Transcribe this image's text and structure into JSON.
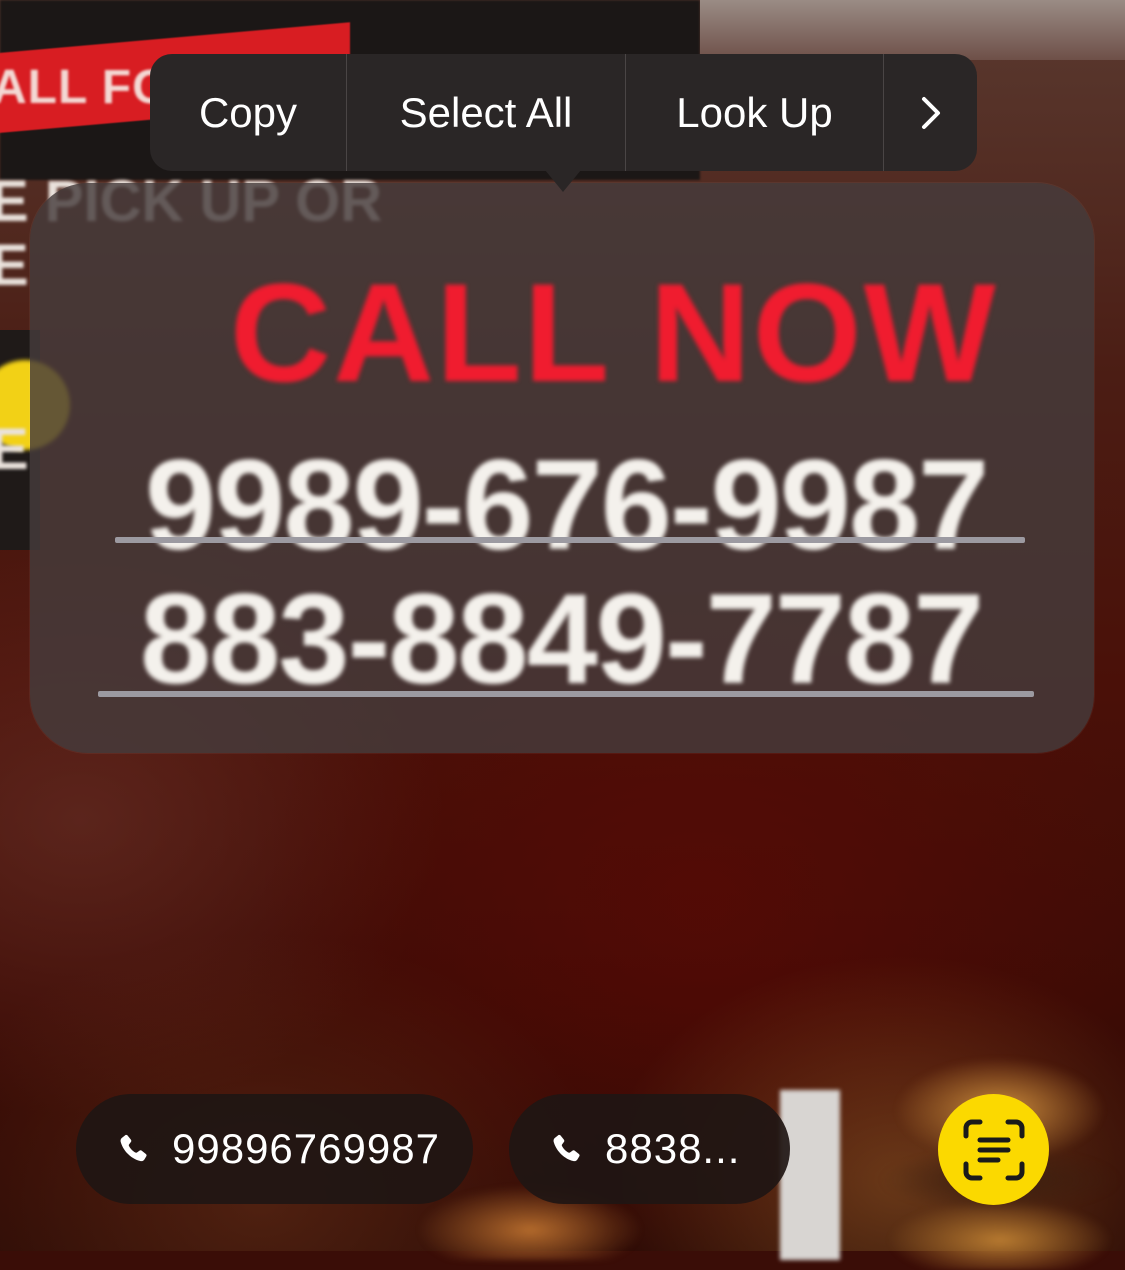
{
  "background": {
    "band_text": "ALL FO",
    "left_text_lines": [
      "E PICK UP OR",
      "E",
      "E"
    ]
  },
  "context_menu": {
    "copy": "Copy",
    "select_all": "Select All",
    "look_up": "Look Up",
    "more_icon": "chevron-right-icon"
  },
  "detected_text": {
    "headline": "CALL NOW",
    "phone_1": "9989-676-9987",
    "phone_2": "883-8849-7787"
  },
  "quick_actions": [
    {
      "icon": "phone-icon",
      "label": "99896769987"
    },
    {
      "icon": "phone-icon",
      "label": "8838..."
    }
  ],
  "live_text_button": {
    "icon": "live-text-scan-icon"
  },
  "colors": {
    "accent_yellow": "#fbd900",
    "headline_red": "#f01c2f",
    "menu_bg": "#2a2626"
  }
}
